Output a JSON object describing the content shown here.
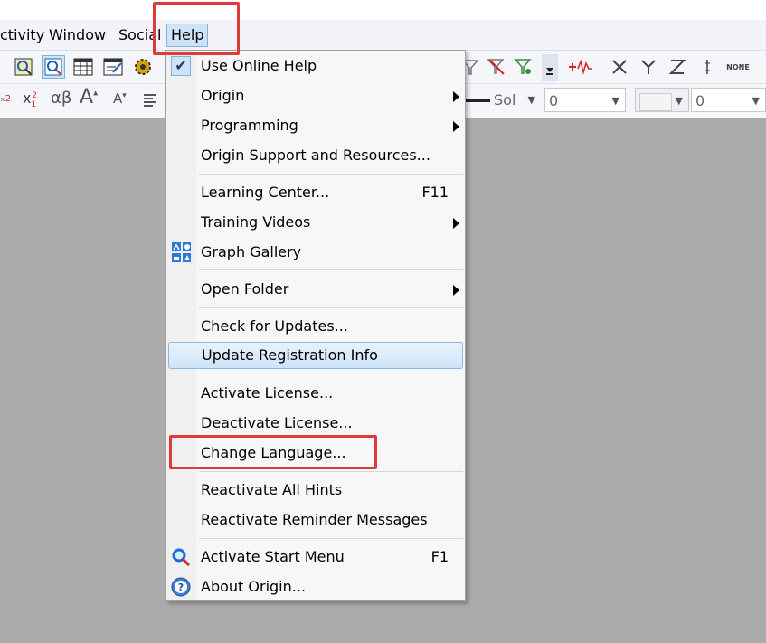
{
  "menubar": {
    "items": [
      {
        "label": "ctivity"
      },
      {
        "label": "Window"
      },
      {
        "label": "Social"
      },
      {
        "label": "Help"
      }
    ]
  },
  "toolbar": {
    "icons": [
      "zoom-page-icon",
      "zoom-data-icon",
      "worksheet-icon",
      "notes-icon",
      "settings-gear-icon"
    ],
    "format_text": {
      "subscript": "x₂",
      "superscript": "x",
      "greek": "αβ",
      "increase_font": "A",
      "decrease_font": "A"
    },
    "right_icons": [
      "filter-icon",
      "filter-remove-icon",
      "filter-settings-icon",
      "add-plot-icon",
      "x-icon",
      "y-icon",
      "z-icon",
      "label-icon",
      "none-icon"
    ],
    "none_label": "NONE",
    "line_style_value": "Sol",
    "width_value": "0",
    "pattern_value": "",
    "angle_value": "0"
  },
  "help_menu": {
    "items": [
      {
        "label": "Use Online Help",
        "checked": true
      },
      {
        "label": "Origin",
        "submenu": true
      },
      {
        "label": "Programming",
        "submenu": true
      },
      {
        "label": "Origin Support and Resources..."
      },
      {
        "label": "Learning Center...",
        "shortcut": "F11"
      },
      {
        "label": "Training Videos",
        "submenu": true
      },
      {
        "label": "Graph Gallery",
        "icon": "graph-gallery-icon"
      },
      {
        "label": "Open Folder",
        "submenu": true
      },
      {
        "label": "Check for Updates..."
      },
      {
        "label": "Update Registration Info",
        "highlighted": true
      },
      {
        "label": "Activate License..."
      },
      {
        "label": "Deactivate License..."
      },
      {
        "label": "Change Language..."
      },
      {
        "label": "Reactivate All Hints"
      },
      {
        "label": "Reactivate Reminder Messages"
      },
      {
        "label": "Activate Start Menu",
        "shortcut": "F1",
        "icon": "search-icon"
      },
      {
        "label": "About Origin...",
        "icon": "help-circle-icon"
      }
    ]
  },
  "colors": {
    "highlight_box": "#e03b3b",
    "canvas": "#ababab",
    "menu_hover": "#cfe3f7"
  }
}
